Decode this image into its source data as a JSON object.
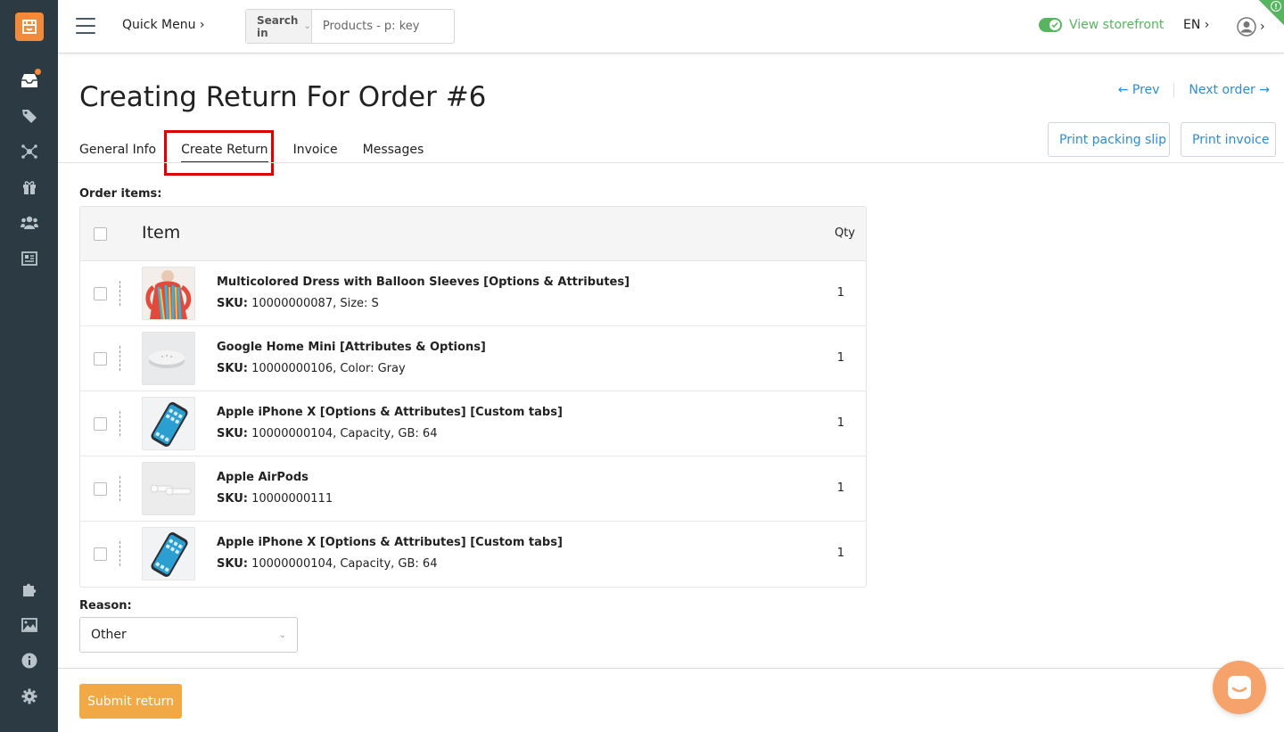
{
  "topbar": {
    "quick_menu": "Quick Menu ›",
    "search_in": "Search in",
    "search_placeholder": "Products - p: key",
    "view_storefront": "View storefront",
    "language": "EN ›",
    "user_chevron": "›",
    "corner_alert": "!"
  },
  "header": {
    "title": "Creating Return For Order #6",
    "prev": "← Prev",
    "next": "Next order →",
    "print_packing_slip": "Print packing slip",
    "print_invoice": "Print invoice"
  },
  "tabs": [
    {
      "label": "General Info"
    },
    {
      "label": "Create Return",
      "active": true
    },
    {
      "label": "Invoice"
    },
    {
      "label": "Messages"
    }
  ],
  "order_items": {
    "label": "Order items:",
    "col_item": "Item",
    "col_qty": "Qty",
    "rows": [
      {
        "name": "Multicolored Dress with Balloon Sleeves [Options & Attributes]",
        "sku_label": "SKU:",
        "sku": "10000000087, Size: S",
        "qty": "1",
        "thumb": "dress-image"
      },
      {
        "name": "Google Home Mini [Attributes & Options]",
        "sku_label": "SKU:",
        "sku": "10000000106, Color: Gray",
        "qty": "1",
        "thumb": "speaker-image"
      },
      {
        "name": "Apple iPhone X [Options & Attributes] [Custom tabs]",
        "sku_label": "SKU:",
        "sku": "10000000104, Capacity, GB: 64",
        "qty": "1",
        "thumb": "phone-image"
      },
      {
        "name": "Apple AirPods",
        "sku_label": "SKU:",
        "sku": "10000000111",
        "qty": "1",
        "thumb": "airpods-image"
      },
      {
        "name": "Apple iPhone X [Options & Attributes] [Custom tabs]",
        "sku_label": "SKU:",
        "sku": "10000000104, Capacity, GB: 64",
        "qty": "1",
        "thumb": "phone-image"
      }
    ]
  },
  "reason": {
    "label": "Reason:",
    "selected": "Other"
  },
  "footer": {
    "submit": "Submit return"
  },
  "colors": {
    "accent": "#f2a845",
    "link": "#2b8cd8",
    "sidebar": "#2c3a43",
    "storefront_green": "#57b55f",
    "logo": "#f28a3a",
    "highlight": "#e00000"
  }
}
